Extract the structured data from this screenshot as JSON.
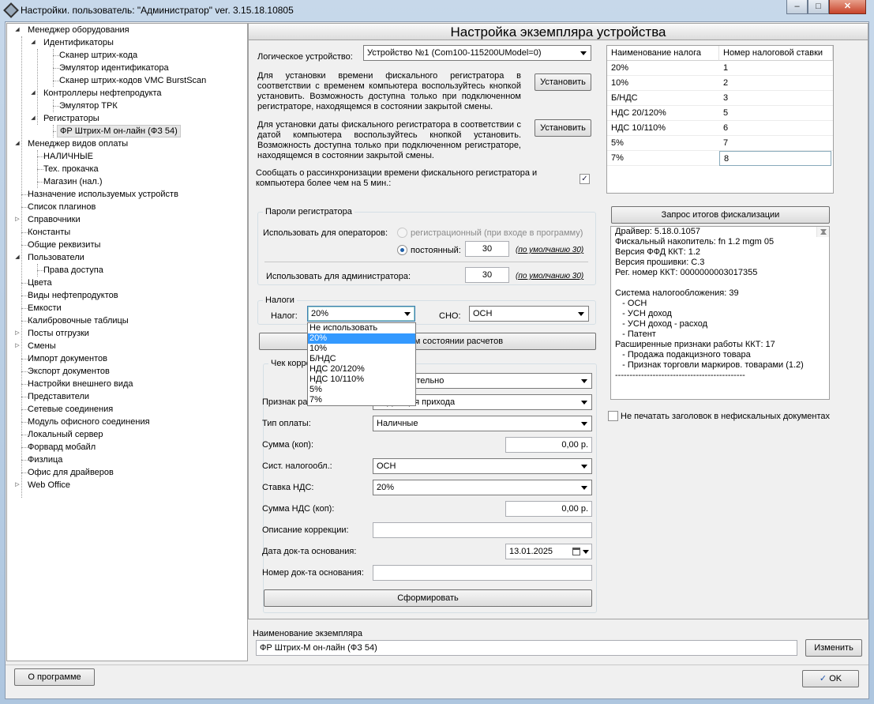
{
  "window": {
    "title": "Настройки. пользователь: \"Администратор\" ver. 3.15.18.10805",
    "minimize": "–",
    "maximize": "□",
    "close": "✕"
  },
  "tree": {
    "items": [
      {
        "label": "Менеджер оборудования"
      },
      {
        "label": "Идентификаторы"
      },
      {
        "label": "Сканер штрих-кода"
      },
      {
        "label": "Эмулятор идентификатора"
      },
      {
        "label": "Сканер штрих-кодов VMC BurstScan"
      },
      {
        "label": "Контроллеры нефтепродукта"
      },
      {
        "label": "Эмулятор ТРК"
      },
      {
        "label": "Регистраторы"
      },
      {
        "label": "ФР Штрих-М он-лайн (ФЗ 54)"
      },
      {
        "label": "Менеджер видов оплаты"
      },
      {
        "label": "НАЛИЧНЫЕ"
      },
      {
        "label": "Тех. прокачка"
      },
      {
        "label": "Магазин (нал.)"
      },
      {
        "label": "Назначение используемых устройств"
      },
      {
        "label": "Список плагинов"
      },
      {
        "label": "Справочники"
      },
      {
        "label": "Константы"
      },
      {
        "label": "Общие реквизиты"
      },
      {
        "label": "Пользователи"
      },
      {
        "label": "Права доступа"
      },
      {
        "label": "Цвета"
      },
      {
        "label": "Виды нефтепродуктов"
      },
      {
        "label": "Емкости"
      },
      {
        "label": "Калибровочные таблицы"
      },
      {
        "label": "Посты отгрузки"
      },
      {
        "label": "Смены"
      },
      {
        "label": "Импорт документов"
      },
      {
        "label": "Экспорт документов"
      },
      {
        "label": "Настройки внешнего вида"
      },
      {
        "label": "Представители"
      },
      {
        "label": "Сетевые соединения"
      },
      {
        "label": "Модуль офисного соединения"
      },
      {
        "label": "Локальный сервер"
      },
      {
        "label": "Форвард мобайл"
      },
      {
        "label": "Физлица"
      },
      {
        "label": "Офис для драйверов"
      },
      {
        "label": "Web Office"
      }
    ]
  },
  "panel": {
    "header": "Настройка экземпляра устройства",
    "logical_device_label": "Логическое устройство:",
    "logical_device_value": "Устройство №1 (Com100-115200UModel=0)",
    "time_text": "Для установки времени фискального регистратора в соответствии с временем компьютера воспользуйтесь кнопкой установить. Возможность доступна только при подключенном регистраторе, находящемся в состоянии закрытой смены.",
    "date_text": "Для установки даты фискального регистратора в соответствии с датой компьютера воспользуйтесь кнопкой установить. Возможность доступна только при подключенном регистраторе, находящемся в состоянии закрытой смены.",
    "set_button_1": "Установить",
    "set_button_2": "Установить",
    "desync_text": "Сообщать о рассинхронизации времени фискального регистратора и компьютера более чем на 5 мин.:",
    "desync_checked": "✓"
  },
  "passwords": {
    "group_title": "Пароли регистратора",
    "operators_label": "Использовать для операторов:",
    "registration_option": "регистрационный (при входе в программу)",
    "permanent_option": "постоянный:",
    "permanent_value": "30",
    "default_hint_1": "(по умолчанию 30)",
    "admin_label": "Использовать для администратора:",
    "admin_value": "30",
    "default_hint_2": "(по умолчанию 30)"
  },
  "taxes": {
    "group_title": "Налоги",
    "tax_label": "Налог:",
    "tax_value": "20%",
    "sno_label": "СНО:",
    "sno_value": "ОСН",
    "dropdown_options": [
      "Не использовать",
      "20%",
      "10%",
      "Б/НДС",
      "НДС 20/120%",
      "НДС 10/110%",
      "5%",
      "7%"
    ],
    "dropdown_highlighted": "20%"
  },
  "report_button": "Отчет о текущем состоянии расчетов",
  "correction": {
    "group_title": "Чек коррекции",
    "type_value": "Самостоятельно",
    "sign_label": "Признак расчета:",
    "sign_value": "Коррекция прихода",
    "pay_type_label": "Тип оплаты:",
    "pay_type_value": "Наличные",
    "sum_label": "Сумма (коп):",
    "sum_value": "0,00 р.",
    "tax_system_label": "Сист. налогообл.:",
    "tax_system_value": "ОСН",
    "vat_rate_label": "Ставка НДС:",
    "vat_rate_value": "20%",
    "vat_sum_label": "Сумма НДС (коп):",
    "vat_sum_value": "0,00 р.",
    "description_label": "Описание коррекции:",
    "description_value": "",
    "base_date_label": "Дата док-та основания:",
    "base_date_value": "13.01.2025",
    "base_number_label": "Номер док-та основания:",
    "base_number_value": "",
    "form_button": "Сформировать"
  },
  "tax_grid": {
    "col_name": "Наименование налога",
    "col_number": "Номер налоговой ставки",
    "rows": [
      {
        "name": "20%",
        "number": "1"
      },
      {
        "name": "10%",
        "number": "2"
      },
      {
        "name": "Б/НДС",
        "number": "3"
      },
      {
        "name": "НДС 20/120%",
        "number": "5"
      },
      {
        "name": "НДС 10/110%",
        "number": "6"
      },
      {
        "name": "5%",
        "number": "7"
      },
      {
        "name": "7%",
        "number": "8"
      }
    ]
  },
  "fiscal": {
    "request_button": "Запрос итогов фискализации",
    "lines": [
      "Драйвер: 5.18.0.1057",
      "Фискальный накопитель: fn 1.2 mgm 05",
      "Версия ФФД ККТ: 1.2",
      "Версия прошивки: C.3",
      "Рег. номер ККТ: 0000000003017355",
      "",
      "Система налогообложения: 39",
      "   - ОСН",
      "   - УСН доход",
      "   - УСН доход - расход",
      "   - Патент",
      "Расширенные признаки работы ККТ: 17",
      "   - Продажа подакцизного товара",
      "   - Признак торговли маркиров. товарами (1.2)",
      "---------------------------------------------"
    ],
    "no_header_label": "Не печатать заголовок в нефискальных документах"
  },
  "instance": {
    "label": "Наименование экземпляра",
    "value": "ФР Штрих-М он-лайн (ФЗ 54)",
    "change_button": "Изменить"
  },
  "footer": {
    "about_button": "О программе",
    "ok_button": "OK"
  }
}
